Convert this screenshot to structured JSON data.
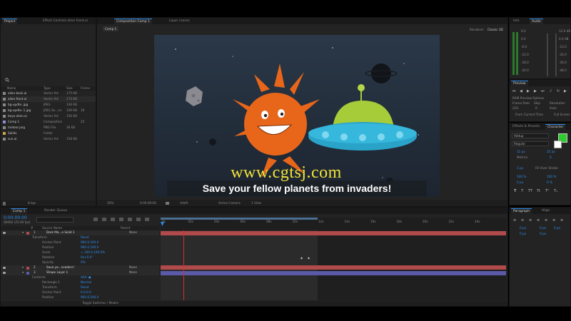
{
  "project_panel": {
    "tabs": [
      "Project",
      "Effect Controls alien front.ai"
    ],
    "columns": [
      "Name",
      "Type",
      "Size",
      "Frame"
    ],
    "items": [
      {
        "name": "alien back.ai",
        "type": "Vector Art",
        "size": "175 KB",
        "frame": ""
      },
      {
        "name": "alien front.ai",
        "type": "Vector Art",
        "size": "174 KB",
        "frame": ""
      },
      {
        "name": "bg-updte..jpg",
        "type": "JPEG",
        "size": "106 KB",
        "frame": ""
      },
      {
        "name": "bg-updte..1.jpg",
        "type": "JPEG Se...ce",
        "size": "106 KB",
        "frame": "30"
      },
      {
        "name": "boya alien.ai",
        "type": "Vector Art",
        "size": "156 KB",
        "frame": ""
      },
      {
        "name": "Comp 1",
        "type": "Composition",
        "size": "",
        "frame": "25"
      },
      {
        "name": "meteor.png",
        "type": "PNG File",
        "size": "36 KB",
        "frame": ""
      },
      {
        "name": "Solids",
        "type": "Folder",
        "size": "",
        "frame": ""
      },
      {
        "name": "sun.ai",
        "type": "Vector Art",
        "size": "158 KB",
        "frame": ""
      }
    ],
    "bpc": "8 bpc"
  },
  "composition_panel": {
    "tabs": [
      "Composition Comp 1",
      "Layer (none)"
    ],
    "subtab": "Comp 1",
    "renderer_label": "Renderer:",
    "renderer_value": "Classic 3D",
    "caption": "Save your fellow planets from invaders!",
    "watermark": "www.cgtsj.com",
    "footer": {
      "zoom": "50%",
      "timecode": "0:00:00:00",
      "resolution": "(Half)",
      "camera": "Active Camera",
      "view": "1 View"
    }
  },
  "info_panel": {
    "tabs": [
      "Info",
      "Audio"
    ],
    "db_labels": [
      "6.0",
      "0.0",
      "-6.0",
      "-12.0",
      "-18.0",
      "-24.0"
    ],
    "db_labels_right": [
      "12.0 dB",
      "0.0 dB",
      "-12.0",
      "-24.0",
      "-36.0",
      "-48.0"
    ]
  },
  "preview_panel": {
    "title": "Preview",
    "ram_preview": "RAM Preview Options",
    "labels": [
      "Frame Rate",
      "Skip",
      "Resolution"
    ],
    "values": [
      "(25)",
      "0",
      "Auto"
    ],
    "from_current": "From Current Time",
    "full_screen": "Full Screen"
  },
  "character_panel": {
    "tabs": [
      "Effects & Presets",
      "Character"
    ],
    "font": "Addup",
    "style": "Regular",
    "size": "11 px",
    "leading": "25 px",
    "kerning": "Metrics",
    "tracking": "0",
    "stroke": "Fill Over Stroke",
    "stroke_width": "1 px",
    "vscale": "100 %",
    "hscale": "100 %",
    "baseline": "0 px",
    "tsume": "0 %",
    "fill_color": "#2ecc2e"
  },
  "paragraph_panel": {
    "tabs": [
      "Paragraph",
      "Align"
    ],
    "indent_values": [
      "0 px",
      "0 px",
      "0 px",
      "0 px",
      "0 px"
    ]
  },
  "timeline": {
    "tabs": [
      "Comp 1",
      "Render Queue"
    ],
    "timecode": "0:00:00:00",
    "frames": "00000 (25.00 fps)",
    "columns": [
      "#",
      "Source Name",
      "Parent"
    ],
    "ruler": [
      "0s",
      "02s",
      "04s",
      "06s",
      "08s",
      "10s",
      "12s",
      "14s",
      "16s",
      "18s",
      "20s",
      "22s",
      "24s"
    ],
    "layers": [
      {
        "num": "1",
        "name": "Dark Ma...e Solid 1",
        "parent": "None",
        "color": "#b14a4a"
      },
      {
        "num": "2",
        "name": "Save yo...nvaders!",
        "parent": "None",
        "color": "#b14a4a"
      },
      {
        "num": "3",
        "name": "Shape Layer 1",
        "parent": "None",
        "color": "#5a5aa8"
      }
    ],
    "props_layer1": [
      {
        "label": "Transform",
        "value": "Reset"
      },
      {
        "label": "Anchor Point",
        "value": "960.0,540.0"
      },
      {
        "label": "Position",
        "value": "960.0,540.0"
      },
      {
        "label": "Scale",
        "value": "∞ 100.0,100.0%"
      },
      {
        "label": "Rotation",
        "value": "0x+0.0°"
      },
      {
        "label": "Opacity",
        "value": "0%"
      }
    ],
    "props_layer3": [
      {
        "label": "Contents",
        "value": "Add: ●"
      },
      {
        "label": "Rectangle 1",
        "value": "Normal"
      },
      {
        "label": "Transform",
        "value": "Reset"
      },
      {
        "label": "Anchor Point",
        "value": "0.0,0.0"
      },
      {
        "label": "Position",
        "value": "960.0,540.0"
      }
    ],
    "toggle": "Toggle Switches / Modes"
  },
  "colors": {
    "accent": "#2d8ceb",
    "layer_red": "#b14a4a",
    "layer_blue": "#5a5aa8",
    "playhead": "#d03030"
  }
}
